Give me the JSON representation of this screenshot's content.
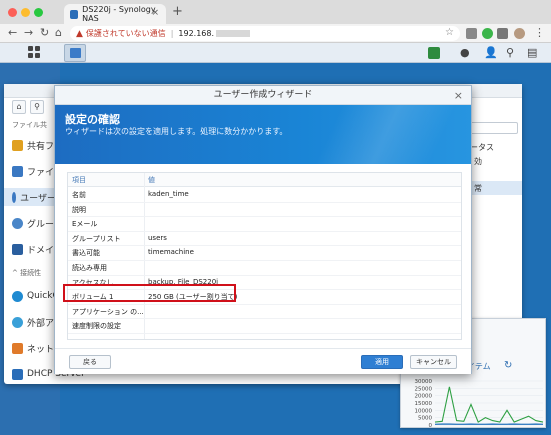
{
  "browser": {
    "tab_title": "DS220j - Synology NAS",
    "tab_close": "×",
    "new_tab": "+",
    "url_warning": "保護されていない通信",
    "url_host": "192.168."
  },
  "control_panel": {
    "sidebar": [
      {
        "label": "ファイル共",
        "kind": "category"
      },
      {
        "label": "共有フ",
        "icon_color": "#e0a020"
      },
      {
        "label": "ファイ",
        "icon_color": "#3a78c2"
      },
      {
        "label": "ユーザー",
        "icon_color": "#3a78c2",
        "selected": true
      },
      {
        "label": "グルー",
        "icon_color": "#4a86c8"
      },
      {
        "label": "ドメイ",
        "icon_color": "#2a5e9e"
      },
      {
        "label": "接続性",
        "kind": "category"
      },
      {
        "label": "QuickC",
        "icon_color": "#1f8ad1"
      },
      {
        "label": "外部ア",
        "icon_color": "#3aa0d8"
      },
      {
        "label": "ネット",
        "icon_color": "#e07a2a"
      },
      {
        "label": "DHCP Server",
        "icon_color": "#2a6db8"
      }
    ],
    "right_header": "ータス",
    "right_cells": [
      "効",
      "常"
    ]
  },
  "resource_monitor": {
    "item_label": "イテム",
    "y_ticks": [
      "30000",
      "25000",
      "20000",
      "15000",
      "10000",
      "5000",
      "0"
    ],
    "series": [
      {
        "color": "#2ea043",
        "values": [
          2000,
          2500,
          26000,
          3000,
          2500,
          14000,
          2000,
          5000,
          3000,
          2000,
          10000,
          2000,
          4000,
          6000,
          3000,
          2000
        ]
      },
      {
        "color": "#3b82c4",
        "values": [
          500,
          600,
          600,
          500,
          500,
          600,
          500,
          500,
          600,
          500,
          500,
          600,
          500,
          500,
          600,
          500
        ]
      }
    ]
  },
  "wizard": {
    "title": "ユーザー作成ウィザード",
    "close": "×",
    "heading": "設定の確認",
    "subheading": "ウィザードは次の設定を適用します。処理に数分かかります。",
    "columns": [
      "項目",
      "値"
    ],
    "rows": [
      {
        "item": "名前",
        "value": "kaden_time"
      },
      {
        "item": "説明",
        "value": ""
      },
      {
        "item": "Eメール",
        "value": ""
      },
      {
        "item": "グループリスト",
        "value": "users"
      },
      {
        "item": "書込可能",
        "value": "timemachine"
      },
      {
        "item": "読込み専用",
        "value": ""
      },
      {
        "item": "アクセスなし",
        "value": "backup, File_DS220j"
      },
      {
        "item": "ボリューム 1",
        "value": "250 GB (ユーザー割り当て)"
      },
      {
        "item": "アプリケーション の...",
        "value": ""
      },
      {
        "item": "速度制限の設定",
        "value": ""
      }
    ],
    "buttons": {
      "back": "戻る",
      "apply": "適用",
      "cancel": "キャンセル"
    }
  },
  "colors": {
    "banner": "#1a85d6",
    "highlight": "#d0101a",
    "apply": "#2f7fd3"
  }
}
